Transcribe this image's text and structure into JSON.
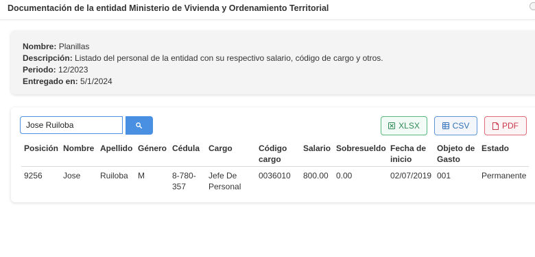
{
  "window": {
    "title": "Documentación de la entidad Ministerio de Vivienda y Ordenamiento Territorial"
  },
  "info": {
    "nombre_label": "Nombre:",
    "nombre_value": "Planillas",
    "descripcion_label": "Descripción:",
    "descripcion_value": "Listado del personal de la entidad con su respectivo salario, código de cargo y otros.",
    "periodo_label": "Periodo:",
    "periodo_value": "12/2023",
    "entregado_label": "Entregado en:",
    "entregado_value": "5/1/2024"
  },
  "search": {
    "value": "Jose Ruiloba",
    "button_icon": "search-icon"
  },
  "export": {
    "xlsx_label": "XLSX",
    "csv_label": "CSV",
    "pdf_label": "PDF"
  },
  "table": {
    "headers": {
      "posicion": "Posición",
      "nombre": "Nombre",
      "apellido": "Apellido",
      "genero": "Género",
      "cedula": "Cédula",
      "cargo": "Cargo",
      "codigo_cargo_1": "Código",
      "codigo_cargo_2": "cargo",
      "salario": "Salario",
      "sobresueldo": "Sobresueldo",
      "fecha_inicio_1": "Fecha de",
      "fecha_inicio_2": "inicio",
      "objeto_gasto_1": "Objeto de",
      "objeto_gasto_2": "Gasto",
      "estado": "Estado"
    },
    "rows": [
      {
        "posicion": "9256",
        "nombre": "Jose",
        "apellido": "Ruiloba",
        "genero": "M",
        "cedula_1": "8-780-",
        "cedula_2": "357",
        "cargo_1": "Jefe De",
        "cargo_2": "Personal",
        "codigo_cargo": "0036010",
        "salario": "800.00",
        "sobresueldo": "0.00",
        "fecha_inicio": "02/07/2019",
        "objeto_gasto": "001",
        "estado": "Permanente"
      }
    ]
  },
  "colors": {
    "primary": "#4a90e2",
    "xlsx": "#2e8b57",
    "csv": "#2f6fb7",
    "pdf": "#c9384a"
  }
}
